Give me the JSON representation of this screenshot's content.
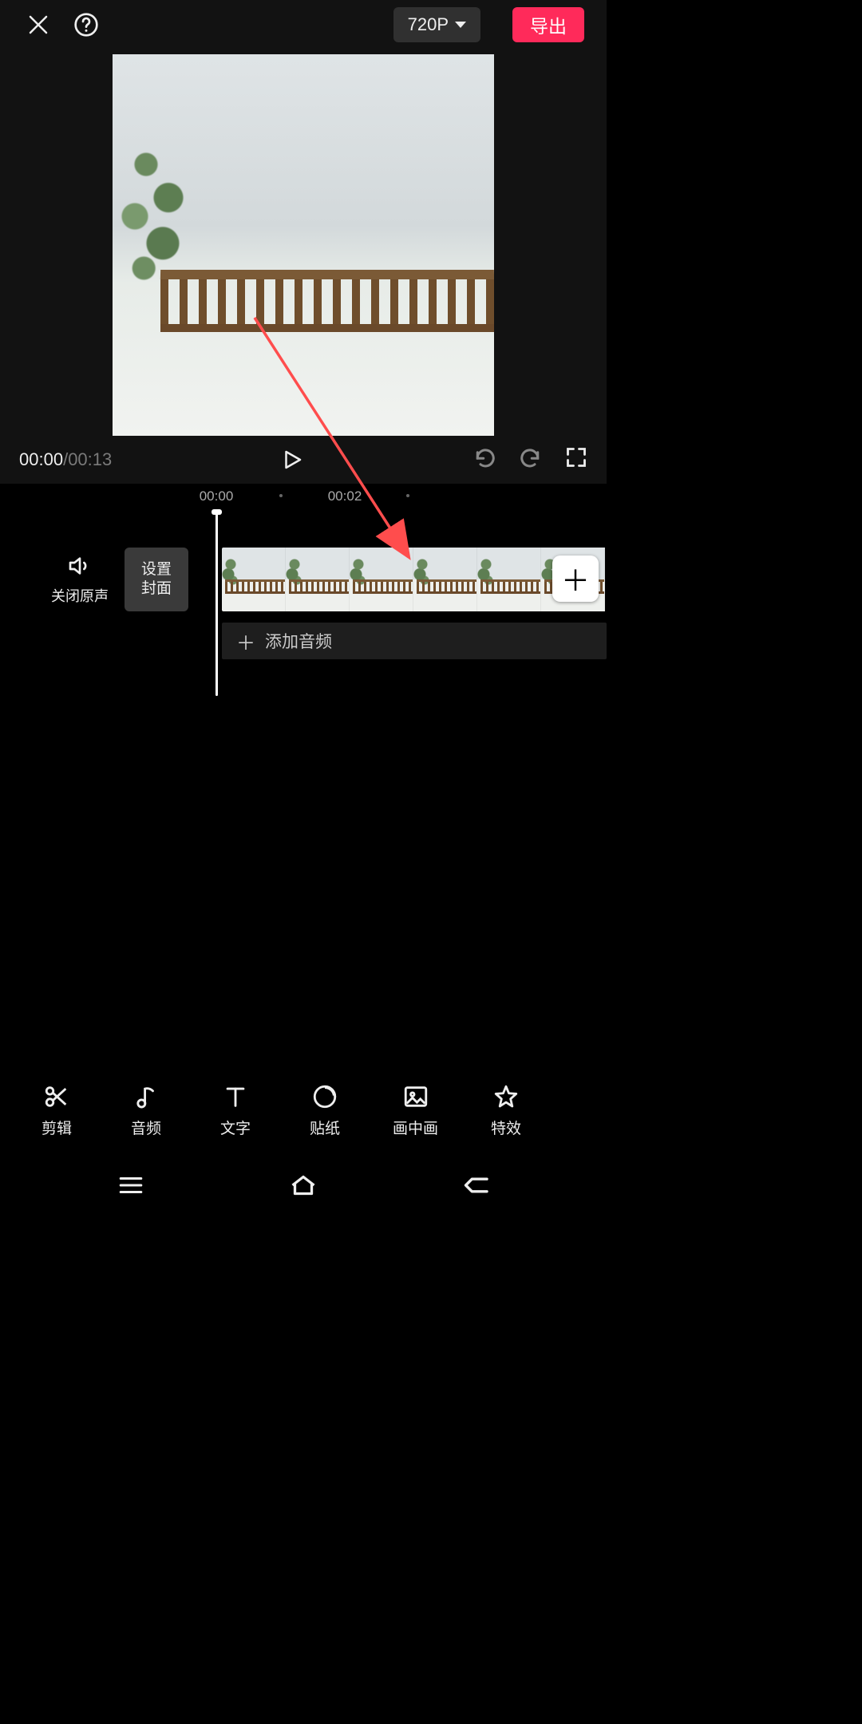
{
  "header": {
    "resolution": "720P",
    "export_label": "导出"
  },
  "player": {
    "current_time": "00:00",
    "separator": " / ",
    "duration": "00:13"
  },
  "timeline": {
    "ruler_ticks": [
      "00:00",
      "00:02"
    ],
    "mute_label": "关闭原声",
    "cover_label": "设置\n封面",
    "add_audio_label": "添加音频"
  },
  "toolbar": {
    "items": [
      {
        "id": "cut",
        "label": "剪辑"
      },
      {
        "id": "audio",
        "label": "音频"
      },
      {
        "id": "text",
        "label": "文字"
      },
      {
        "id": "sticker",
        "label": "贴纸"
      },
      {
        "id": "pip",
        "label": "画中画"
      },
      {
        "id": "fx",
        "label": "特效"
      }
    ]
  }
}
